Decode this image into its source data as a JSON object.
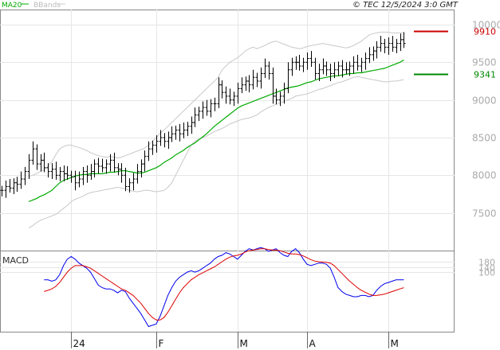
{
  "header": {
    "ma_label": "MA20",
    "bb_label": "BBands",
    "copyright": "© TEC 12/5/2024 3:0 GMT"
  },
  "colors": {
    "ma": "#00aa00",
    "bands": "#c8c8c8",
    "price": "#000000",
    "resistance": "#cc0000",
    "support": "#008800",
    "macd": "#0000ee",
    "signal": "#dd0000",
    "grid": "#e6e6e6"
  },
  "chart_data": [
    {
      "type": "ohlc",
      "ylim": [
        7000,
        10200
      ],
      "y_ticks": [
        {
          "value": 7500,
          "label": "7500"
        },
        {
          "value": 8000,
          "label": "8000"
        },
        {
          "value": 8500,
          "label": "8500"
        },
        {
          "value": 9000,
          "label": "9000"
        },
        {
          "value": 9500,
          "label": "9500"
        },
        {
          "value": 10000,
          "label": "10000"
        }
      ],
      "x_ticks": [
        {
          "index": 18,
          "label": "24"
        },
        {
          "index": 40,
          "label": "F"
        },
        {
          "index": 61,
          "label": "M"
        },
        {
          "index": 79,
          "label": "A"
        },
        {
          "index": 100,
          "label": "M"
        }
      ],
      "n_slots": 118,
      "ma_name": "MA20",
      "bands_name": "BBands",
      "levels": [
        {
          "value": 9910,
          "label": "9910",
          "color": "#cc0000"
        },
        {
          "value": 9341,
          "label": "9341",
          "color": "#008800"
        }
      ],
      "close": [
        7800,
        7850,
        7830,
        7900,
        7880,
        7950,
        8050,
        8200,
        8350,
        8150,
        8200,
        8100,
        8050,
        8080,
        8000,
        8050,
        8020,
        8000,
        7980,
        7900,
        7950,
        8050,
        8000,
        8050,
        8150,
        8120,
        8100,
        8150,
        8200,
        8100,
        8080,
        8000,
        7850,
        7900,
        7950,
        8050,
        8150,
        8250,
        8350,
        8400,
        8450,
        8500,
        8450,
        8500,
        8550,
        8600,
        8550,
        8600,
        8650,
        8700,
        8800,
        8850,
        8900,
        8850,
        8950,
        8950,
        9200,
        9100,
        9050,
        9000,
        9050,
        9150,
        9200,
        9250,
        9200,
        9300,
        9250,
        9350,
        9450,
        9350,
        9050,
        9000,
        9050,
        9150,
        9400,
        9500,
        9500,
        9450,
        9500,
        9550,
        9500,
        9350,
        9400,
        9450,
        9400,
        9350,
        9400,
        9450,
        9400,
        9400,
        9450,
        9500,
        9450,
        9500,
        9550,
        9600,
        9650,
        9700,
        9750,
        9700,
        9750,
        9700,
        9750,
        9800,
        9750
      ],
      "ma20": [
        7650,
        7670,
        7690,
        7720,
        7740,
        7770,
        7800,
        7850,
        7900,
        7930,
        7950,
        7970,
        7990,
        8000,
        8010,
        8010,
        8020,
        8020,
        8020,
        8020,
        8030,
        8040,
        8040,
        8050,
        8060,
        8060,
        8050,
        8040,
        8030,
        8030,
        8040,
        8060,
        8080,
        8100,
        8130,
        8170,
        8200,
        8230,
        8270,
        8300,
        8330,
        8370,
        8400,
        8430,
        8470,
        8510,
        8550,
        8600,
        8650,
        8690,
        8730,
        8770,
        8810,
        8850,
        8890,
        8920,
        8940,
        8960,
        8980,
        9000,
        9020,
        9040,
        9060,
        9080,
        9100,
        9120,
        9140,
        9160,
        9170,
        9180,
        9190,
        9210,
        9230,
        9240,
        9260,
        9280,
        9290,
        9300,
        9310,
        9320,
        9320,
        9330,
        9340,
        9350,
        9350,
        9360,
        9360,
        9370,
        9380,
        9390,
        9400,
        9410,
        9420,
        9440,
        9460,
        9480,
        9500,
        9530
      ],
      "bb_upper": [
        7980,
        8000,
        8020,
        8050,
        8070,
        8120,
        8180,
        8270,
        8350,
        8380,
        8400,
        8400,
        8380,
        8370,
        8350,
        8330,
        8300,
        8280,
        8260,
        8250,
        8240,
        8250,
        8240,
        8230,
        8240,
        8260,
        8280,
        8300,
        8320,
        8340,
        8360,
        8400,
        8450,
        8500,
        8560,
        8600,
        8650,
        8700,
        8750,
        8800,
        8850,
        8900,
        8950,
        9000,
        9050,
        9100,
        9150,
        9200,
        9250,
        9300,
        9400,
        9450,
        9500,
        9530,
        9560,
        9600,
        9650,
        9680,
        9700,
        9680,
        9700,
        9720,
        9750,
        9770,
        9780,
        9760,
        9740,
        9720,
        9700,
        9690,
        9680,
        9690,
        9710,
        9720,
        9730,
        9740,
        9750,
        9740,
        9730,
        9720,
        9710,
        9700,
        9690,
        9700,
        9720,
        9750,
        9780,
        9820,
        9860,
        9880,
        9890,
        9900,
        9900,
        9900,
        9890,
        9890,
        9890,
        9890
      ],
      "bb_lower": [
        7300,
        7330,
        7370,
        7400,
        7420,
        7440,
        7460,
        7480,
        7520,
        7560,
        7600,
        7650,
        7680,
        7700,
        7720,
        7750,
        7770,
        7780,
        7790,
        7800,
        7810,
        7820,
        7830,
        7840,
        7830,
        7820,
        7800,
        7790,
        7780,
        7790,
        7800,
        7800,
        7790,
        7780,
        7790,
        7800,
        7840,
        7900,
        8000,
        8100,
        8200,
        8300,
        8400,
        8450,
        8480,
        8500,
        8520,
        8550,
        8580,
        8600,
        8620,
        8650,
        8680,
        8700,
        8720,
        8740,
        8750,
        8760,
        8780,
        8800,
        8840,
        8870,
        8900,
        8920,
        8940,
        8960,
        8980,
        9000,
        9020,
        9050,
        9060,
        9070,
        9080,
        9100,
        9120,
        9140,
        9150,
        9170,
        9190,
        9210,
        9230,
        9240,
        9260,
        9280,
        9300,
        9310,
        9300,
        9290,
        9280,
        9270,
        9260,
        9250,
        9240,
        9240,
        9250,
        9250,
        9260,
        9270
      ]
    },
    {
      "type": "line",
      "title": "MACD",
      "ylim": [
        -360,
        260
      ],
      "y_ticks": [
        {
          "value": 100,
          "label": "100"
        },
        {
          "value": 140,
          "label": "140"
        },
        {
          "value": 180,
          "label": "180"
        }
      ],
      "series": [
        {
          "key": "macd",
          "values": [
            40,
            40,
            30,
            40,
            80,
            150,
            200,
            220,
            200,
            170,
            150,
            130,
            100,
            50,
            0,
            -20,
            -30,
            -30,
            -40,
            -60,
            -40,
            -50,
            -100,
            -140,
            -180,
            -220,
            -270,
            -320,
            -310,
            -300,
            -240,
            -160,
            -80,
            -20,
            30,
            60,
            80,
            100,
            110,
            100,
            110,
            130,
            150,
            170,
            200,
            220,
            230,
            250,
            240,
            220,
            200,
            230,
            260,
            280,
            270,
            280,
            290,
            280,
            260,
            270,
            280,
            250,
            230,
            220,
            260,
            280,
            250,
            200,
            160,
            150,
            160,
            170,
            170,
            160,
            130,
            60,
            -20,
            -50,
            -70,
            -80,
            -90,
            -90,
            -80,
            -80,
            -90,
            -80,
            -40,
            -10,
            10,
            20,
            30,
            40,
            40,
            40
          ],
          "color": "#0000ee"
        },
        {
          "key": "signal",
          "values": [
            -50,
            -40,
            -30,
            -10,
            20,
            60,
            100,
            130,
            150,
            150,
            150,
            140,
            130,
            110,
            90,
            70,
            50,
            30,
            10,
            -10,
            -30,
            -40,
            -60,
            -80,
            -110,
            -140,
            -180,
            -220,
            -250,
            -270,
            -270,
            -250,
            -210,
            -160,
            -110,
            -60,
            -20,
            10,
            40,
            60,
            80,
            95,
            110,
            125,
            140,
            160,
            180,
            200,
            215,
            225,
            230,
            240,
            255,
            265,
            270,
            275,
            280,
            280,
            275,
            270,
            270,
            265,
            255,
            245,
            240,
            240,
            235,
            225,
            210,
            195,
            185,
            180,
            178,
            175,
            170,
            150,
            120,
            90,
            60,
            30,
            5,
            -20,
            -40,
            -55,
            -70,
            -80,
            -80,
            -75,
            -70,
            -60,
            -50,
            -40,
            -30,
            -20
          ],
          "color": "#dd0000"
        }
      ]
    }
  ]
}
